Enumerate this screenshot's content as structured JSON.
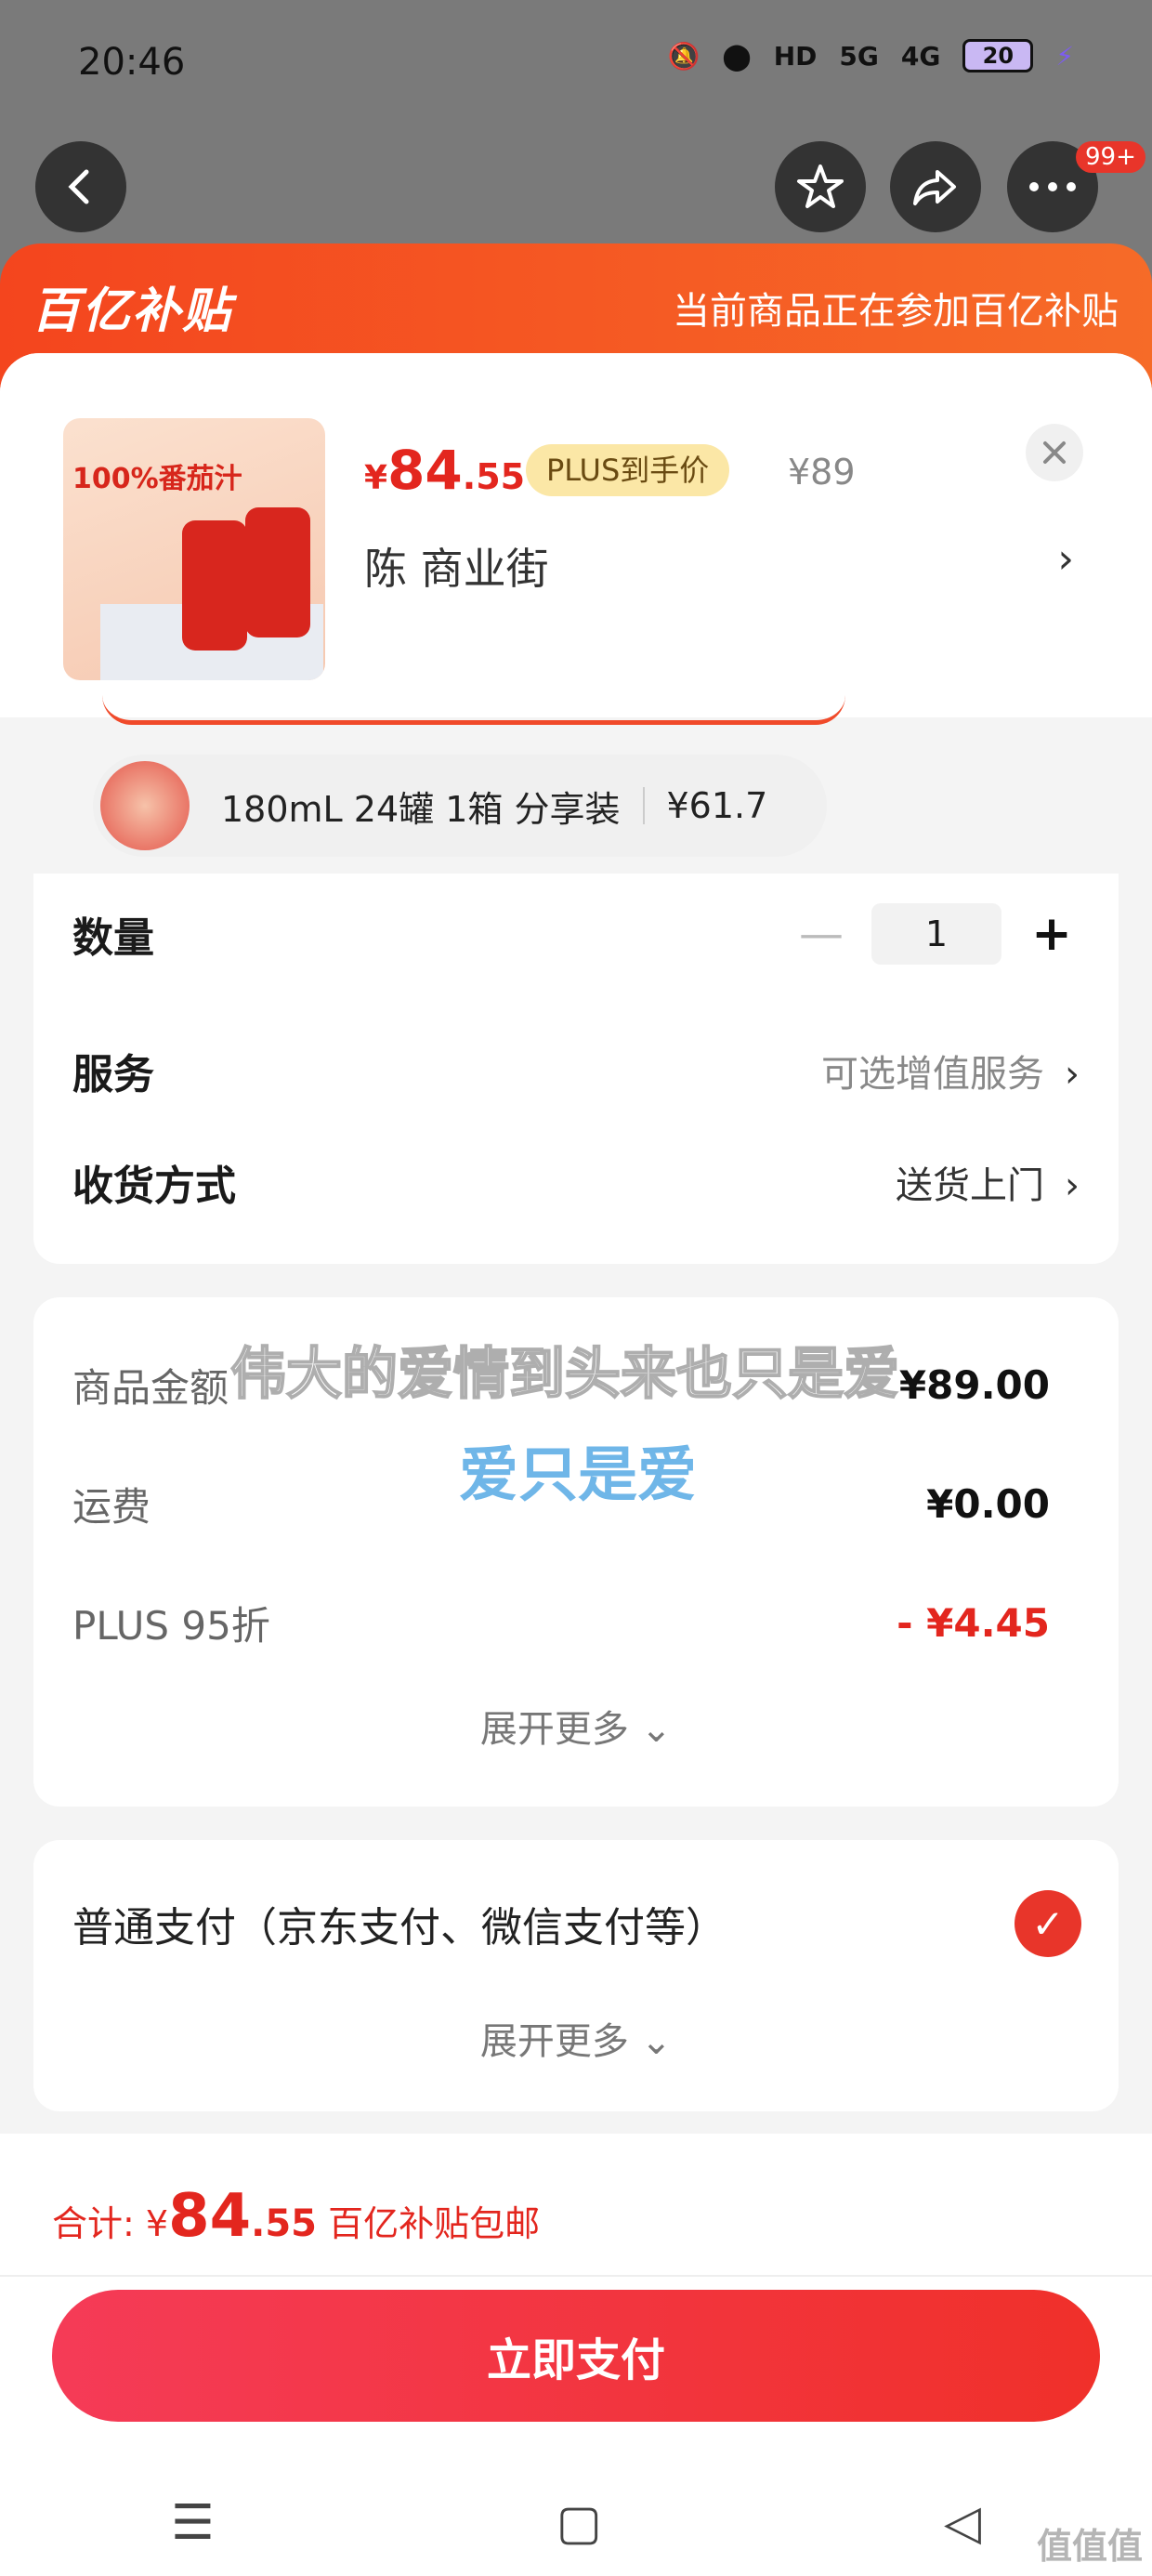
{
  "status_bar": {
    "time": "20:46",
    "signal1": "5G",
    "signal2": "4G",
    "battery": "20"
  },
  "nav": {
    "more_badge": "99+"
  },
  "banner": {
    "logo": "百亿补贴",
    "message": "当前商品正在参加百亿补贴"
  },
  "product": {
    "image_title": "100%番茄汁",
    "price_yen": "¥",
    "price_int": "84",
    "price_dec": ".55",
    "plus_tag": "PLUS到手价",
    "original_price": "¥89",
    "address": "陈  商业街"
  },
  "spec": {
    "label": "180mL 24罐 1箱 分享装",
    "price": "¥61.7"
  },
  "quantity": {
    "label": "数量",
    "value": "1"
  },
  "service": {
    "label": "服务",
    "value": "可选增值服务"
  },
  "delivery": {
    "label": "收货方式",
    "value": "送货上门"
  },
  "costs": {
    "items": [
      {
        "label": "商品金额",
        "value": "¥89.00"
      },
      {
        "label": "运费",
        "value": "¥0.00"
      },
      {
        "label": "PLUS 95折",
        "value": "- ¥4.45"
      }
    ],
    "expand": "展开更多"
  },
  "overlay": {
    "line1": "伟大的爱情到头来也只是爱",
    "line2": "爱只是爱"
  },
  "payment": {
    "method": "普通支付（京东支付、微信支付等）",
    "expand": "展开更多"
  },
  "footer": {
    "total_label": "合计: ",
    "total_yen": "¥",
    "total_int": "84",
    "total_dec": ".55",
    "total_note": " 百亿补贴包邮",
    "pay_button": "立即支付"
  },
  "watermark": "值值值"
}
